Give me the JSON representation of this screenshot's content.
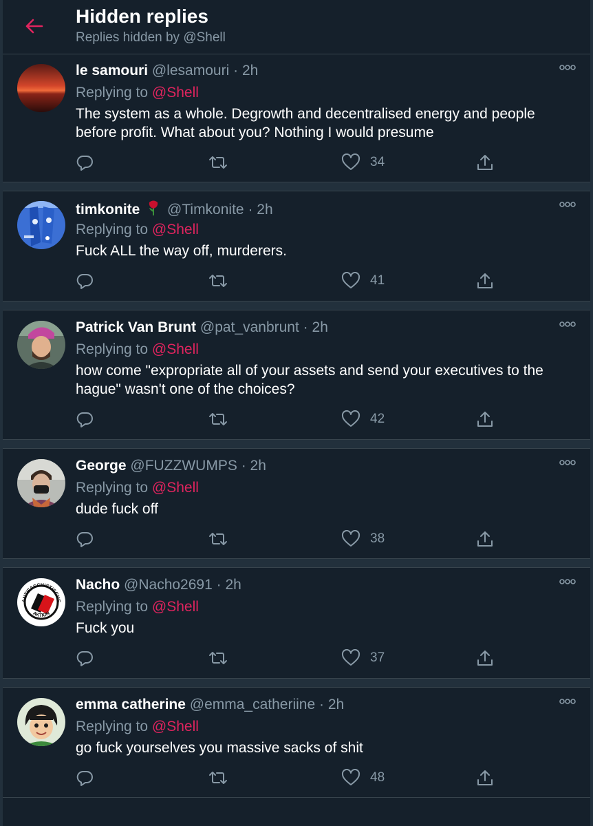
{
  "header": {
    "title": "Hidden replies",
    "subtitle": "Replies hidden by @Shell"
  },
  "reply_label": "Replying to",
  "tweets": [
    {
      "name": "le samouri",
      "handle": "@lesamouri",
      "time": "2h",
      "reply_to": "@Shell",
      "text": "The system as a whole. Degrowth and decentralised energy and people before profit. What about you? Nothing I would presume",
      "likes": "34"
    },
    {
      "name": "timkonite",
      "handle": "@Timkonite",
      "time": "2h",
      "reply_to": "@Shell",
      "text": "Fuck ALL the way off, murderers.",
      "likes": "41"
    },
    {
      "name": "Patrick Van Brunt",
      "handle": "@pat_vanbrunt",
      "time": "2h",
      "reply_to": "@Shell",
      "text": "how come \"expropriate all of your assets and send your executives to the hague\" wasn't one of the choices?",
      "likes": "42"
    },
    {
      "name": "George",
      "handle": "@FUZZWUMPS",
      "time": "2h",
      "reply_to": "@Shell",
      "text": "dude fuck off",
      "likes": "38"
    },
    {
      "name": "Nacho",
      "handle": "@Nacho2691",
      "time": "2h",
      "reply_to": "@Shell",
      "text": "Fuck you",
      "likes": "37"
    },
    {
      "name": "emma catherine",
      "handle": "@emma_catheriine",
      "time": "2h",
      "reply_to": "@Shell",
      "text": "go fuck yourselves you massive sacks of shit",
      "likes": "48"
    }
  ],
  "avatar_logo_text": "ANTIFASCHISTISCHE AKTION",
  "colors": {
    "background": "#15202b",
    "separator": "#22303c",
    "muted": "#8899a6",
    "accent": "#e0245e"
  },
  "icons": [
    "back-arrow-icon",
    "reply-icon",
    "retweet-icon",
    "like-icon",
    "share-icon",
    "more-icon",
    "rose-emoji-icon"
  ]
}
